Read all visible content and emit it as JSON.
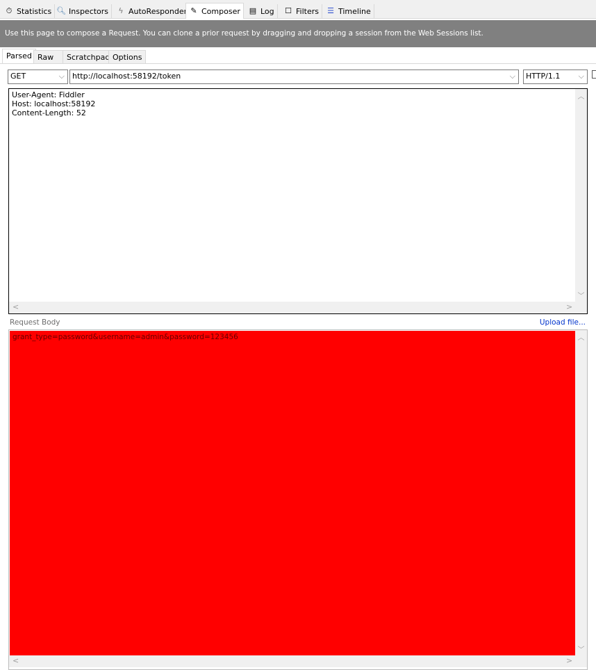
{
  "top_tabs": [
    {
      "label": "Statistics",
      "icon": "stopwatch-icon"
    },
    {
      "label": "Inspectors",
      "icon": "magnifier-icon"
    },
    {
      "label": "AutoResponder",
      "icon": "lightning-icon"
    },
    {
      "label": "Composer",
      "icon": "pencil-icon",
      "active": true
    },
    {
      "label": "Log",
      "icon": "document-icon"
    },
    {
      "label": "Filters",
      "icon": "checkbox-icon"
    },
    {
      "label": "Timeline",
      "icon": "timeline-icon"
    }
  ],
  "banner": "Use this page to compose a Request. You can clone a prior request by dragging and dropping a session from the Web Sessions list.",
  "sub_tabs": [
    "Parsed",
    "Raw",
    "Scratchpad",
    "Options"
  ],
  "method": "GET",
  "url": "http://localhost:58192/token",
  "version": "HTTP/1.1",
  "headers": [
    "User-Agent: Fiddler",
    "Host: localhost:58192",
    "Content-Length: 52"
  ],
  "request_body_label": "Request Body",
  "upload_link": "Upload file...",
  "body": "grant_type=password&username=admin&password=123456",
  "colors": {
    "body_background": "#ff0000",
    "banner": "#808080",
    "link": "#0033cc"
  }
}
